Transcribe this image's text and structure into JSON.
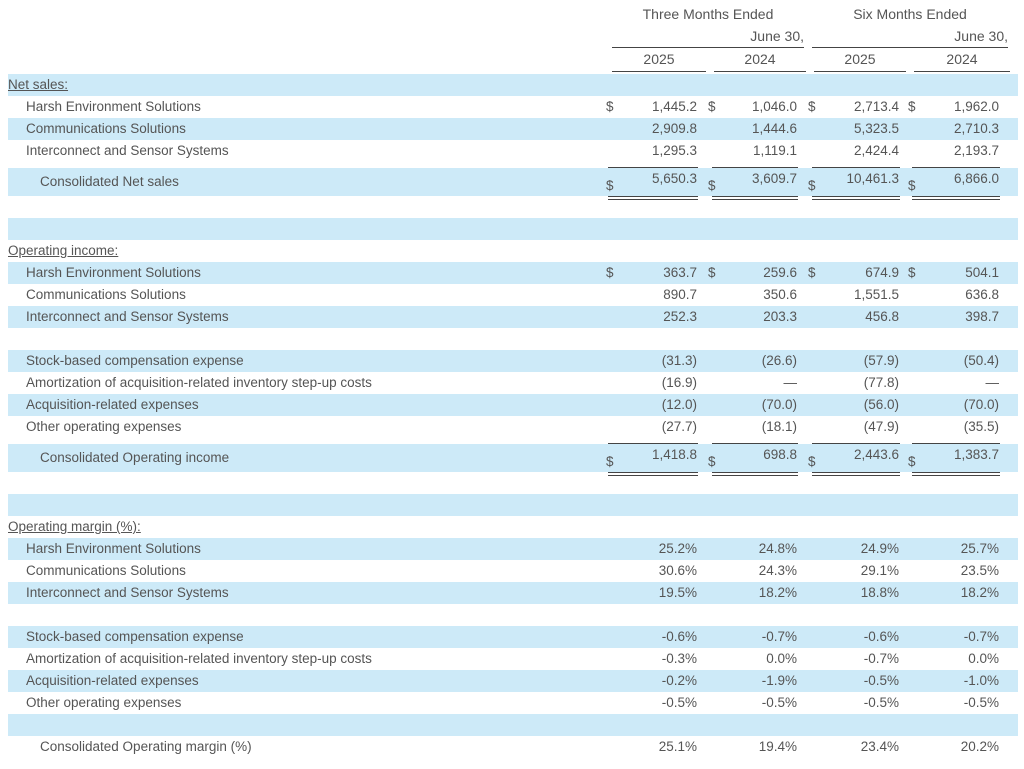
{
  "header": {
    "three_months_line1": "Three Months Ended",
    "three_months_line2": "June 30,",
    "six_months_line1": "Six Months Ended",
    "six_months_line2": "June 30,",
    "years": [
      "2025",
      "2024",
      "2025",
      "2024"
    ]
  },
  "rows": [
    {
      "kind": "section",
      "label": "Net sales:",
      "shaded": true
    },
    {
      "kind": "item",
      "label": "Harsh Environment Solutions",
      "shaded": false,
      "dollar": true,
      "values": [
        "1,445.2",
        "1,046.0",
        "2,713.4",
        "1,962.0"
      ]
    },
    {
      "kind": "item",
      "label": "Communications Solutions",
      "shaded": true,
      "values": [
        "2,909.8",
        "1,444.6",
        "5,323.5",
        "2,710.3"
      ]
    },
    {
      "kind": "item",
      "label": "Interconnect and Sensor Systems",
      "shaded": false,
      "values": [
        "1,295.3",
        "1,119.1",
        "2,424.4",
        "2,193.7"
      ]
    },
    {
      "kind": "total",
      "label": "Consolidated Net sales",
      "shaded": true,
      "dollar": true,
      "values": [
        "5,650.3",
        "3,609.7",
        "10,461.3",
        "6,866.0"
      ]
    },
    {
      "kind": "blank",
      "shaded": true
    },
    {
      "kind": "section",
      "label": "Operating income:",
      "shaded": false
    },
    {
      "kind": "item",
      "label": "Harsh Environment Solutions",
      "shaded": true,
      "dollar": true,
      "values": [
        "363.7",
        "259.6",
        "674.9",
        "504.1"
      ]
    },
    {
      "kind": "item",
      "label": "Communications Solutions",
      "shaded": false,
      "values": [
        "890.7",
        "350.6",
        "1,551.5",
        "636.8"
      ]
    },
    {
      "kind": "item",
      "label": "Interconnect and Sensor Systems",
      "shaded": true,
      "values": [
        "252.3",
        "203.3",
        "456.8",
        "398.7"
      ]
    },
    {
      "kind": "blank",
      "shaded": false
    },
    {
      "kind": "item",
      "label": "Stock-based compensation expense",
      "shaded": true,
      "values": [
        "(31.3)",
        "(26.6)",
        "(57.9)",
        "(50.4)"
      ]
    },
    {
      "kind": "item",
      "label": "Amortization of acquisition-related inventory step-up costs",
      "shaded": false,
      "values": [
        "(16.9)",
        "—",
        "(77.8)",
        "—"
      ]
    },
    {
      "kind": "item",
      "label": "Acquisition-related expenses",
      "shaded": true,
      "values": [
        "(12.0)",
        "(70.0)",
        "(56.0)",
        "(70.0)"
      ]
    },
    {
      "kind": "item",
      "label": "Other operating expenses",
      "shaded": false,
      "values": [
        "(27.7)",
        "(18.1)",
        "(47.9)",
        "(35.5)"
      ]
    },
    {
      "kind": "total",
      "label": "Consolidated Operating income",
      "shaded": true,
      "dollar": true,
      "values": [
        "1,418.8",
        "698.8",
        "2,443.6",
        "1,383.7"
      ]
    },
    {
      "kind": "blank",
      "shaded": true
    },
    {
      "kind": "section",
      "label": "Operating margin (%):",
      "shaded": false
    },
    {
      "kind": "item",
      "label": "Harsh Environment Solutions",
      "shaded": true,
      "values": [
        "25.2%",
        "24.8%",
        "24.9%",
        "25.7%"
      ]
    },
    {
      "kind": "item",
      "label": "Communications Solutions",
      "shaded": false,
      "values": [
        "30.6%",
        "24.3%",
        "29.1%",
        "23.5%"
      ]
    },
    {
      "kind": "item",
      "label": "Interconnect and Sensor Systems",
      "shaded": true,
      "values": [
        "19.5%",
        "18.2%",
        "18.8%",
        "18.2%"
      ]
    },
    {
      "kind": "blank",
      "shaded": false
    },
    {
      "kind": "item",
      "label": "Stock-based compensation expense",
      "shaded": true,
      "values": [
        "-0.6%",
        "-0.7%",
        "-0.6%",
        "-0.7%"
      ]
    },
    {
      "kind": "item",
      "label": "Amortization of acquisition-related inventory step-up costs",
      "shaded": false,
      "values": [
        "-0.3%",
        "0.0%",
        "-0.7%",
        "0.0%"
      ]
    },
    {
      "kind": "item",
      "label": "Acquisition-related expenses",
      "shaded": true,
      "values": [
        "-0.2%",
        "-1.9%",
        "-0.5%",
        "-1.0%"
      ]
    },
    {
      "kind": "item",
      "label": "Other operating expenses",
      "shaded": false,
      "values": [
        "-0.5%",
        "-0.5%",
        "-0.5%",
        "-0.5%"
      ]
    },
    {
      "kind": "blank",
      "shaded": true
    },
    {
      "kind": "marginTotal",
      "label": "Consolidated Operating margin (%)",
      "shaded": false,
      "values": [
        "25.1%",
        "19.4%",
        "23.4%",
        "20.2%"
      ]
    }
  ],
  "currency_symbol": "$"
}
